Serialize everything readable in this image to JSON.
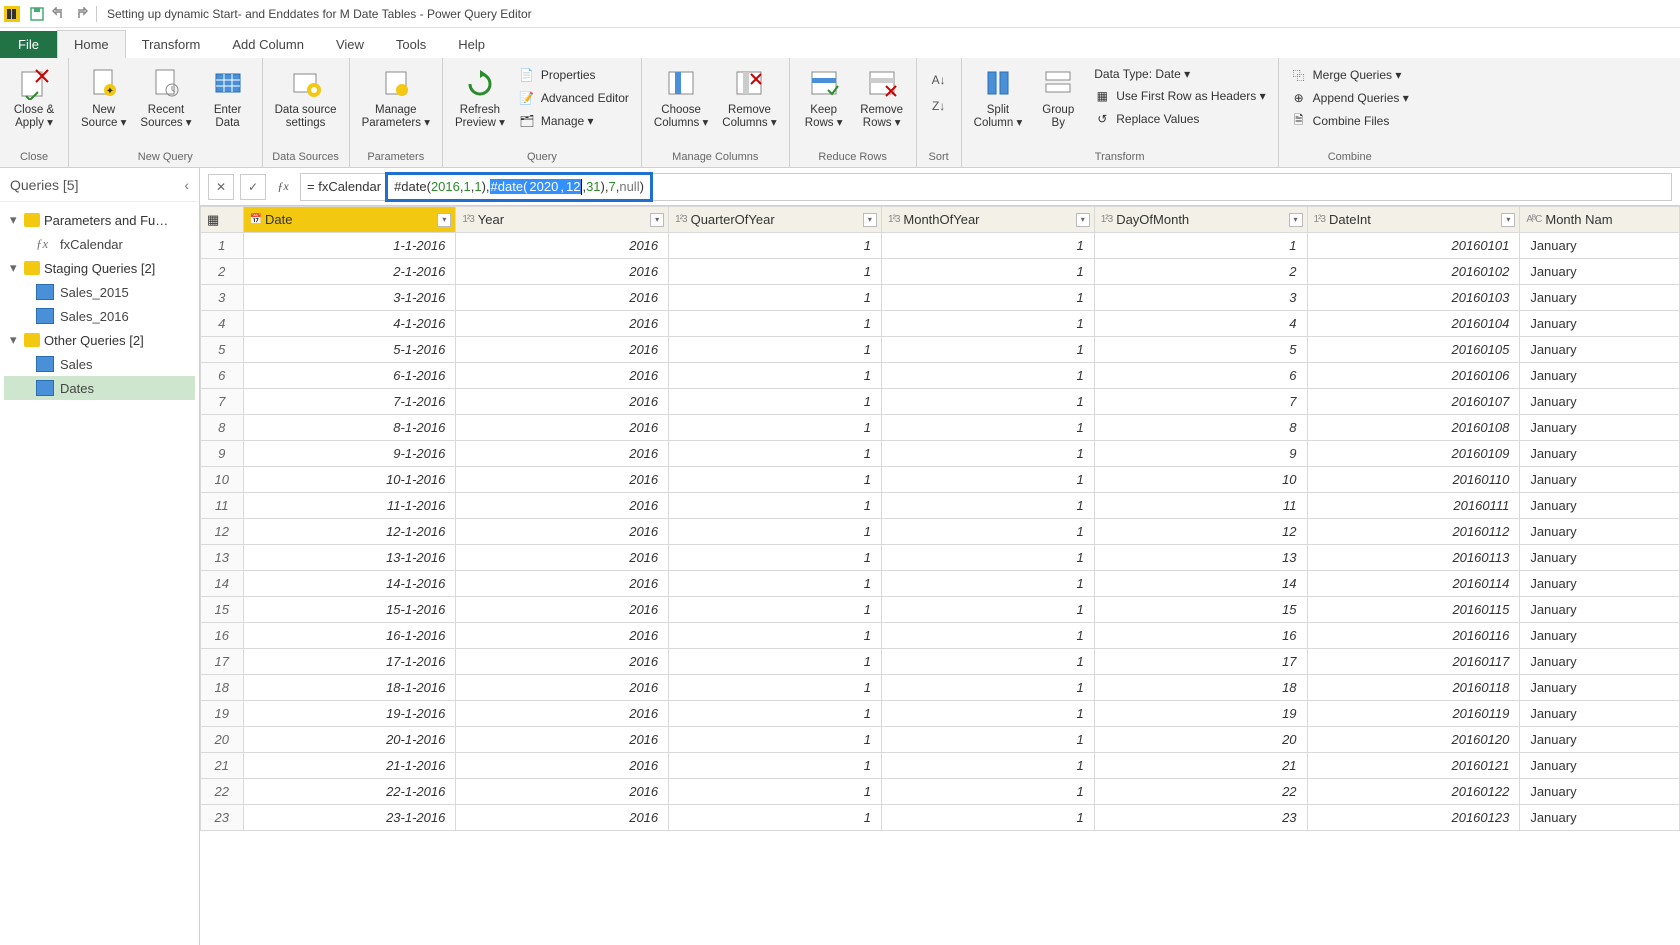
{
  "title": "Setting up dynamic Start- and Enddates for M Date Tables - Power Query Editor",
  "tabs": {
    "file": "File",
    "home": "Home",
    "transform": "Transform",
    "addcol": "Add Column",
    "view": "View",
    "tools": "Tools",
    "help": "Help"
  },
  "ribbon": {
    "close": {
      "closeApply": "Close &\nApply ▾",
      "group": "Close"
    },
    "newq": {
      "newSource": "New\nSource ▾",
      "recent": "Recent\nSources ▾",
      "enter": "Enter\nData",
      "group": "New Query"
    },
    "ds": {
      "settings": "Data source\nsettings",
      "group": "Data Sources"
    },
    "params": {
      "manage": "Manage\nParameters ▾",
      "group": "Parameters"
    },
    "query": {
      "refresh": "Refresh\nPreview ▾",
      "props": "Properties",
      "adv": "Advanced Editor",
      "manage": "Manage ▾",
      "group": "Query"
    },
    "cols": {
      "choose": "Choose\nColumns ▾",
      "remove": "Remove\nColumns ▾",
      "group": "Manage Columns"
    },
    "rows": {
      "keep": "Keep\nRows ▾",
      "remove": "Remove\nRows ▾",
      "group": "Reduce Rows"
    },
    "sort": {
      "group": "Sort"
    },
    "trans": {
      "split": "Split\nColumn ▾",
      "group_by": "Group\nBy",
      "dtype": "Data Type: Date ▾",
      "first": "Use First Row as Headers ▾",
      "replace": "Replace Values",
      "group": "Transform"
    },
    "combine": {
      "merge": "Merge Queries ▾",
      "append": "Append Queries ▾",
      "files": "Combine Files",
      "group": "Combine"
    }
  },
  "sidebar": {
    "title": "Queries [5]",
    "g1": "Parameters and Fu…",
    "i1": "fxCalendar",
    "g2": "Staging Queries [2]",
    "i2": "Sales_2015",
    "i3": "Sales_2016",
    "g3": "Other Queries [2]",
    "i4": "Sales",
    "i5": "Dates"
  },
  "formula": {
    "prefix": "= fxCalendar",
    "p1": "#date( ",
    "n1": "2016",
    "c1": ", ",
    "n2": "1",
    "c2": ", ",
    "n3": "1",
    "p2": "), ",
    "p3": "#date( ",
    "n4": "2020",
    "c3": ", ",
    "n5": "12",
    "c4": ", ",
    "n6": "31",
    "p4": "), ",
    "n7": "7",
    "c5": ", ",
    "nul": "null",
    "p5": ")"
  },
  "columns": {
    "date": "Date",
    "year": "Year",
    "quarter": "QuarterOfYear",
    "month": "MonthOfYear",
    "day": "DayOfMonth",
    "dateint": "DateInt",
    "mname": "Month Nam"
  },
  "rows": [
    {
      "n": 1,
      "date": "1-1-2016",
      "year": 2016,
      "q": 1,
      "m": 1,
      "d": 1,
      "di": 20160101,
      "mn": "January"
    },
    {
      "n": 2,
      "date": "2-1-2016",
      "year": 2016,
      "q": 1,
      "m": 1,
      "d": 2,
      "di": 20160102,
      "mn": "January"
    },
    {
      "n": 3,
      "date": "3-1-2016",
      "year": 2016,
      "q": 1,
      "m": 1,
      "d": 3,
      "di": 20160103,
      "mn": "January"
    },
    {
      "n": 4,
      "date": "4-1-2016",
      "year": 2016,
      "q": 1,
      "m": 1,
      "d": 4,
      "di": 20160104,
      "mn": "January"
    },
    {
      "n": 5,
      "date": "5-1-2016",
      "year": 2016,
      "q": 1,
      "m": 1,
      "d": 5,
      "di": 20160105,
      "mn": "January"
    },
    {
      "n": 6,
      "date": "6-1-2016",
      "year": 2016,
      "q": 1,
      "m": 1,
      "d": 6,
      "di": 20160106,
      "mn": "January"
    },
    {
      "n": 7,
      "date": "7-1-2016",
      "year": 2016,
      "q": 1,
      "m": 1,
      "d": 7,
      "di": 20160107,
      "mn": "January"
    },
    {
      "n": 8,
      "date": "8-1-2016",
      "year": 2016,
      "q": 1,
      "m": 1,
      "d": 8,
      "di": 20160108,
      "mn": "January"
    },
    {
      "n": 9,
      "date": "9-1-2016",
      "year": 2016,
      "q": 1,
      "m": 1,
      "d": 9,
      "di": 20160109,
      "mn": "January"
    },
    {
      "n": 10,
      "date": "10-1-2016",
      "year": 2016,
      "q": 1,
      "m": 1,
      "d": 10,
      "di": 20160110,
      "mn": "January"
    },
    {
      "n": 11,
      "date": "11-1-2016",
      "year": 2016,
      "q": 1,
      "m": 1,
      "d": 11,
      "di": 20160111,
      "mn": "January"
    },
    {
      "n": 12,
      "date": "12-1-2016",
      "year": 2016,
      "q": 1,
      "m": 1,
      "d": 12,
      "di": 20160112,
      "mn": "January"
    },
    {
      "n": 13,
      "date": "13-1-2016",
      "year": 2016,
      "q": 1,
      "m": 1,
      "d": 13,
      "di": 20160113,
      "mn": "January"
    },
    {
      "n": 14,
      "date": "14-1-2016",
      "year": 2016,
      "q": 1,
      "m": 1,
      "d": 14,
      "di": 20160114,
      "mn": "January"
    },
    {
      "n": 15,
      "date": "15-1-2016",
      "year": 2016,
      "q": 1,
      "m": 1,
      "d": 15,
      "di": 20160115,
      "mn": "January"
    },
    {
      "n": 16,
      "date": "16-1-2016",
      "year": 2016,
      "q": 1,
      "m": 1,
      "d": 16,
      "di": 20160116,
      "mn": "January"
    },
    {
      "n": 17,
      "date": "17-1-2016",
      "year": 2016,
      "q": 1,
      "m": 1,
      "d": 17,
      "di": 20160117,
      "mn": "January"
    },
    {
      "n": 18,
      "date": "18-1-2016",
      "year": 2016,
      "q": 1,
      "m": 1,
      "d": 18,
      "di": 20160118,
      "mn": "January"
    },
    {
      "n": 19,
      "date": "19-1-2016",
      "year": 2016,
      "q": 1,
      "m": 1,
      "d": 19,
      "di": 20160119,
      "mn": "January"
    },
    {
      "n": 20,
      "date": "20-1-2016",
      "year": 2016,
      "q": 1,
      "m": 1,
      "d": 20,
      "di": 20160120,
      "mn": "January"
    },
    {
      "n": 21,
      "date": "21-1-2016",
      "year": 2016,
      "q": 1,
      "m": 1,
      "d": 21,
      "di": 20160121,
      "mn": "January"
    },
    {
      "n": 22,
      "date": "22-1-2016",
      "year": 2016,
      "q": 1,
      "m": 1,
      "d": 22,
      "di": 20160122,
      "mn": "January"
    },
    {
      "n": 23,
      "date": "23-1-2016",
      "year": 2016,
      "q": 1,
      "m": 1,
      "d": 23,
      "di": 20160123,
      "mn": "January"
    }
  ]
}
